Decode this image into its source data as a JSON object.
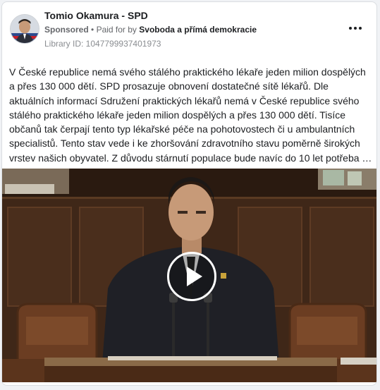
{
  "post": {
    "page_name": "Tomio Okamura - SPD",
    "sponsored_label": "Sponsored",
    "separator": "•",
    "paid_for_by_label": "Paid for by",
    "funder": "Svoboda a přímá demokracie",
    "library_id": "Library ID: 1047799937401973",
    "body": "V České republice nemá svého stálého praktického lékaře jeden milion dospělých a přes 130 000 dětí. SPD prosazuje obnovení dostatečné sítě lékařů. Dle aktuálních informací Sdružení praktických lékařů nemá v České republice svého stálého praktického lékaře jeden milion dospělých a přes 130 000 dětí. Tisíce občanů tak čerpají tento typ lékařské péče na pohotovostech či u ambulantních specialistů. Tento stav vede i ke zhoršování zdravotního stavu poměrně širokých vrstev našich obyvatel. Z důvodu stárnutí populace bude navíc do 10 let potřeba …"
  },
  "icons": {
    "avatar": "profile-photo",
    "more": "more-horizontal-icon",
    "play": "play-icon"
  },
  "colors": {
    "text_primary": "#1c1e21",
    "text_secondary": "#65676b",
    "text_tertiary": "#8a8d91",
    "card_border": "#dadde1",
    "play_overlay": "#ffffff"
  }
}
